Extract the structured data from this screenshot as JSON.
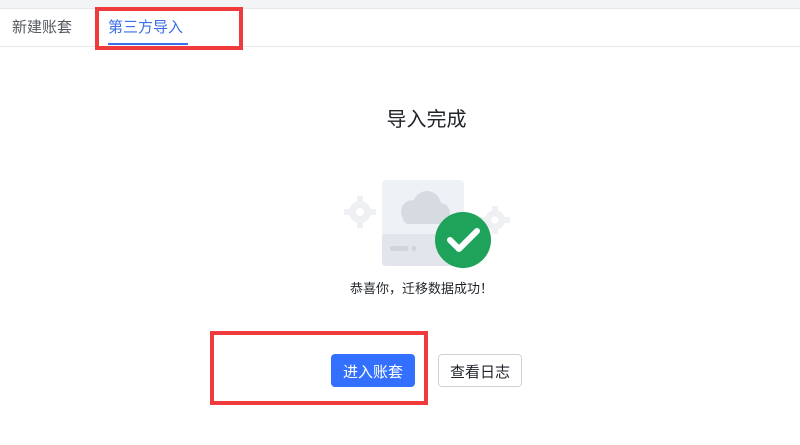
{
  "tabs": [
    {
      "label": "新建账套",
      "active": false
    },
    {
      "label": "第三方导入",
      "active": true
    }
  ],
  "result": {
    "title": "导入完成",
    "message": "恭喜你，迁移数据成功！"
  },
  "actions": {
    "enter_label": "进入账套",
    "log_label": "查看日志"
  },
  "colors": {
    "accent": "#3370ff",
    "success": "#1fa35b",
    "annotation": "#ef3b3b"
  },
  "icons": {
    "success": "check-circle-icon",
    "illustration": "cloud-server-illustration"
  }
}
